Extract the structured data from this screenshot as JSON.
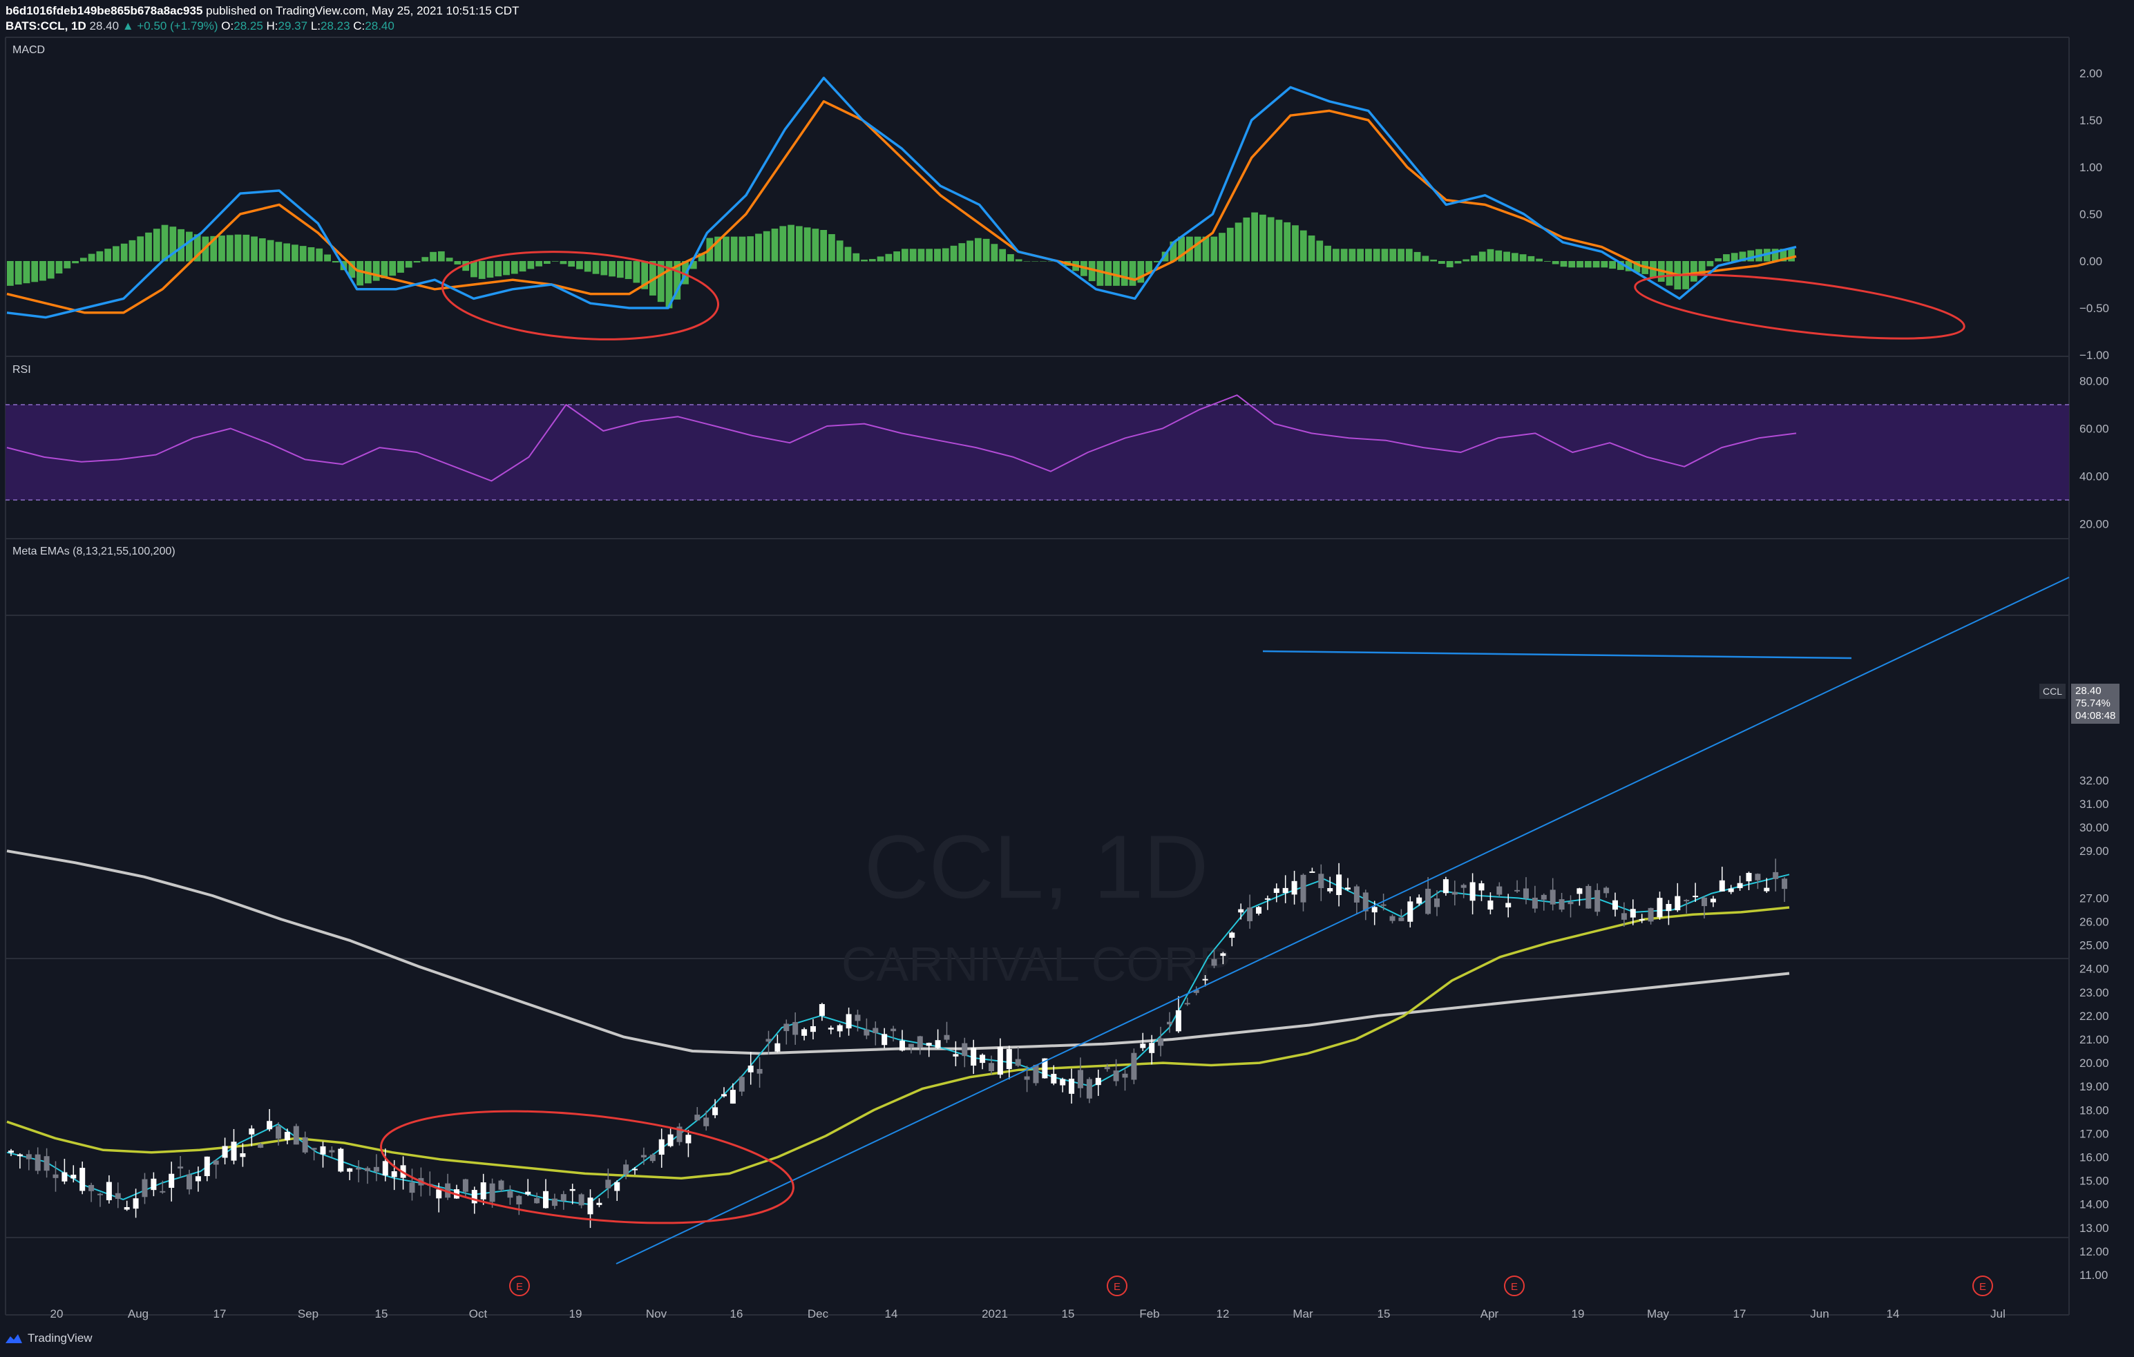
{
  "header": {
    "publisher_line_id": "b6d1016fdeb149be865b678a8ac935",
    "publisher_line_rest": " published on TradingView.com, May 25, 2021 10:51:15 CDT",
    "symbol": "BATS:CCL, 1D",
    "last": "28.40",
    "change": "▲ +0.50 (+1.79%)",
    "o_label": "O:",
    "o": "28.25",
    "h_label": "H:",
    "h": "29.37",
    "l_label": "L:",
    "l": "28.23",
    "c_label": "C:",
    "c": "28.40"
  },
  "panes": {
    "macd": {
      "title": "MACD",
      "ticks": [
        "2.00",
        "1.50",
        "1.00",
        "0.50",
        "0.00",
        "−0.50",
        "−1.00"
      ]
    },
    "rsi": {
      "title": "RSI",
      "ticks": [
        "80.00",
        "60.00",
        "40.00",
        "20.00"
      ]
    },
    "price": {
      "title": "Meta EMAs (8,13,21,55,100,200)",
      "ticks": [
        "32.00",
        "31.00",
        "30.00",
        "29.00",
        "27.00",
        "26.00",
        "25.00",
        "24.00",
        "23.00",
        "22.00",
        "21.00",
        "20.00",
        "19.00",
        "18.00",
        "17.00",
        "16.00",
        "15.00",
        "14.00",
        "13.00",
        "12.00",
        "11.00"
      ]
    }
  },
  "watermark": {
    "symbol": "CCL, 1D",
    "name": "CARNIVAL CORP"
  },
  "price_badge": {
    "symbol": "CCL",
    "price": "28.40",
    "pct": "75.74%",
    "countdown": "04:08:48"
  },
  "x_axis": [
    "20",
    "Aug",
    "17",
    "Sep",
    "15",
    "Oct",
    "19",
    "Nov",
    "16",
    "Dec",
    "14",
    "2021",
    "15",
    "Feb",
    "12",
    "Mar",
    "15",
    "Apr",
    "19",
    "May",
    "17",
    "Jun",
    "14",
    "Jul"
  ],
  "earnings_marker": "E",
  "footer": {
    "brand": "TradingView"
  },
  "colors": {
    "background": "#131722",
    "macd_line": "#2196f3",
    "signal_line": "#ff7f0e",
    "histogram": "#4caf50",
    "rsi_line": "#b24bd6",
    "rsi_band": "#2e1a55",
    "ema_fast": "#26c6da",
    "ema_mid": "#c0ca33",
    "ema_slow": "#c8c8c8",
    "annotation": "#e53935",
    "trendline": "#1e88e5"
  },
  "chart_data": [
    {
      "type": "line",
      "title": "MACD",
      "series": [
        {
          "name": "MACD",
          "values": [
            -0.55,
            -0.6,
            -0.5,
            -0.4,
            0.0,
            0.3,
            0.72,
            0.75,
            0.4,
            -0.3,
            -0.3,
            -0.2,
            -0.4,
            -0.3,
            -0.25,
            -0.45,
            -0.5,
            -0.5,
            0.3,
            0.7,
            1.4,
            1.95,
            1.5,
            1.2,
            0.8,
            0.6,
            0.1,
            0.0,
            -0.3,
            -0.4,
            0.2,
            0.5,
            1.5,
            1.85,
            1.7,
            1.6,
            1.1,
            0.6,
            0.7,
            0.5,
            0.2,
            0.1,
            -0.15,
            -0.4,
            -0.05,
            0.05,
            0.15
          ]
        },
        {
          "name": "Signal",
          "values": [
            -0.35,
            -0.45,
            -0.55,
            -0.55,
            -0.3,
            0.1,
            0.5,
            0.6,
            0.3,
            -0.1,
            -0.2,
            -0.3,
            -0.25,
            -0.2,
            -0.25,
            -0.35,
            -0.35,
            -0.1,
            0.1,
            0.5,
            1.1,
            1.7,
            1.5,
            1.1,
            0.7,
            0.4,
            0.1,
            0.0,
            -0.1,
            -0.2,
            0.0,
            0.3,
            1.1,
            1.55,
            1.6,
            1.5,
            1.0,
            0.65,
            0.6,
            0.45,
            0.25,
            0.15,
            -0.05,
            -0.15,
            -0.1,
            -0.05,
            0.05
          ]
        }
      ]
    },
    {
      "type": "line",
      "title": "RSI",
      "ylim": [
        20,
        80
      ],
      "series": [
        {
          "values": [
            52,
            48,
            46,
            47,
            49,
            56,
            60,
            54,
            47,
            45,
            52,
            50,
            44,
            38,
            48,
            70,
            59,
            63,
            65,
            61,
            57,
            54,
            61,
            62,
            58,
            55,
            52,
            48,
            42,
            50,
            56,
            60,
            68,
            74,
            62,
            58,
            56,
            55,
            52,
            50,
            56,
            58,
            50,
            54,
            48,
            44,
            52,
            56,
            58
          ]
        }
      ]
    },
    {
      "type": "line",
      "title": "CCL, 1D",
      "ylim": [
        11,
        32.5
      ],
      "series": [
        {
          "name": "EMA fast",
          "values": [
            16.2,
            15.8,
            14.8,
            14.2,
            14.9,
            15.4,
            16.6,
            17.4,
            16.2,
            15.6,
            15.1,
            14.8,
            14.4,
            14.6,
            14.2,
            14.0,
            15.3,
            16.5,
            17.8,
            19.5,
            21.5,
            22.0,
            21.5,
            21.0,
            20.7,
            20.2,
            20.0,
            19.4,
            19.0,
            19.9,
            21.5,
            24.5,
            26.5,
            27.2,
            27.8,
            27.0,
            26.2,
            27.3,
            27.1,
            27.0,
            26.8,
            27.0,
            26.4,
            26.5,
            27.2,
            27.6,
            28.0
          ]
        },
        {
          "name": "EMA 55",
          "values": [
            17.5,
            16.8,
            16.3,
            16.2,
            16.3,
            16.5,
            16.8,
            16.6,
            16.2,
            15.9,
            15.7,
            15.5,
            15.3,
            15.2,
            15.1,
            15.3,
            16.0,
            16.9,
            18.0,
            18.9,
            19.4,
            19.7,
            19.8,
            19.9,
            20.0,
            19.9,
            20.0,
            20.4,
            21.0,
            22.0,
            23.5,
            24.5,
            25.1,
            25.6,
            26.1,
            26.3,
            26.4,
            26.6
          ]
        },
        {
          "name": "EMA 200",
          "values": [
            29.0,
            28.5,
            27.9,
            27.1,
            26.1,
            25.2,
            24.1,
            23.1,
            22.1,
            21.1,
            20.5,
            20.4,
            20.5,
            20.6,
            20.6,
            20.7,
            20.8,
            21.0,
            21.3,
            21.6,
            22.0,
            22.3,
            22.6,
            22.9,
            23.2,
            23.5,
            23.8
          ]
        }
      ]
    }
  ]
}
